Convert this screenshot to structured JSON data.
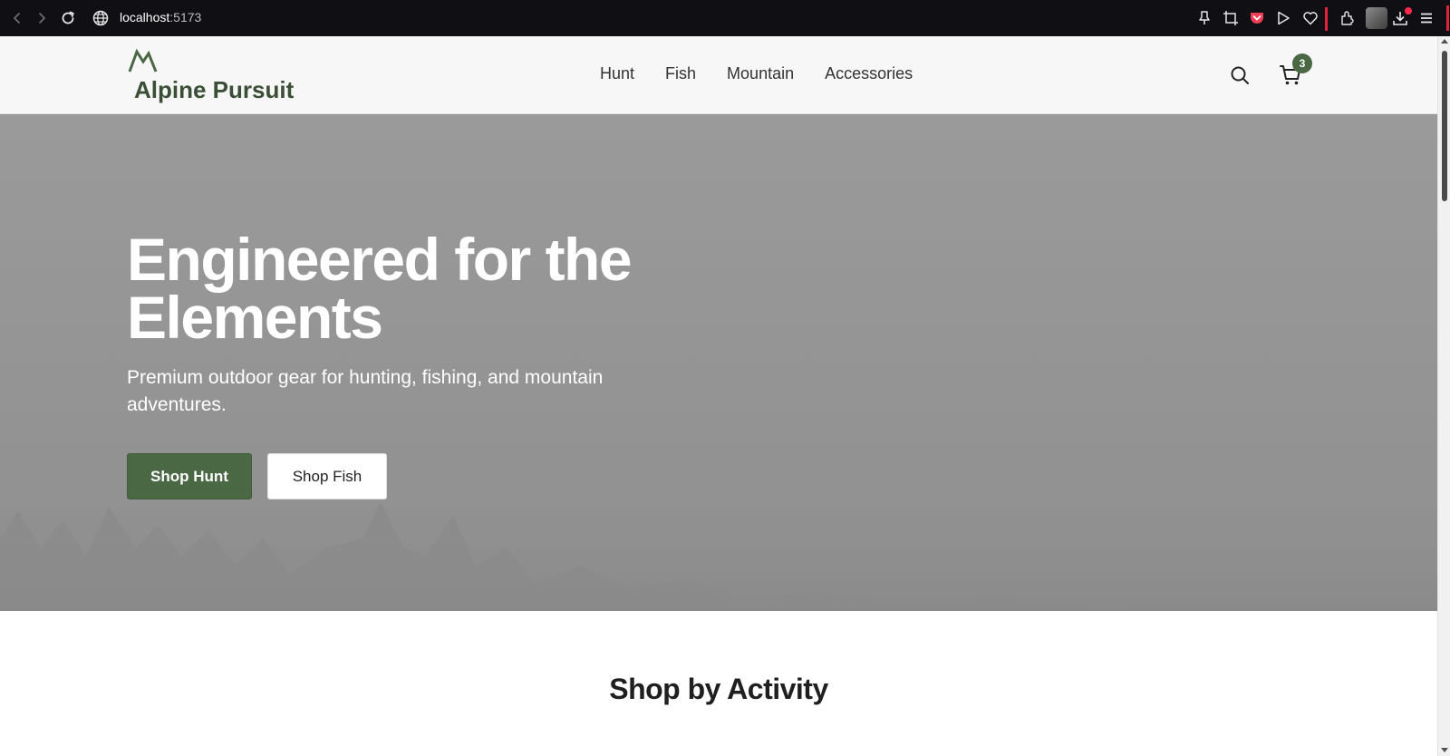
{
  "browser": {
    "url_host": "localhost",
    "url_port": ":5173",
    "icons": [
      "back-icon",
      "forward-icon",
      "reload-icon",
      "site-info-icon",
      "pin-icon",
      "screenshot-icon",
      "pocket-icon",
      "play-icon",
      "heart-icon",
      "extensions-icon",
      "profile-avatar",
      "downloads-icon",
      "menu-icon"
    ]
  },
  "header": {
    "brand": "Alpine Pursuit",
    "nav": [
      {
        "label": "Hunt"
      },
      {
        "label": "Fish"
      },
      {
        "label": "Mountain"
      },
      {
        "label": "Accessories"
      }
    ],
    "cart_count": "3"
  },
  "hero": {
    "title_line1": "Engineered for the",
    "title_line2": "Elements",
    "subtitle": "Premium outdoor gear for hunting, fishing, and mountain adventures.",
    "primary_button": "Shop Hunt",
    "secondary_button": "Shop Fish"
  },
  "section": {
    "title": "Shop by Activity"
  },
  "colors": {
    "brand_green": "#4a6844",
    "logo_text": "#3b4e36",
    "hero_bg": "#969696",
    "chrome_bg": "#0f0f14",
    "accent_red": "#e0223c"
  }
}
